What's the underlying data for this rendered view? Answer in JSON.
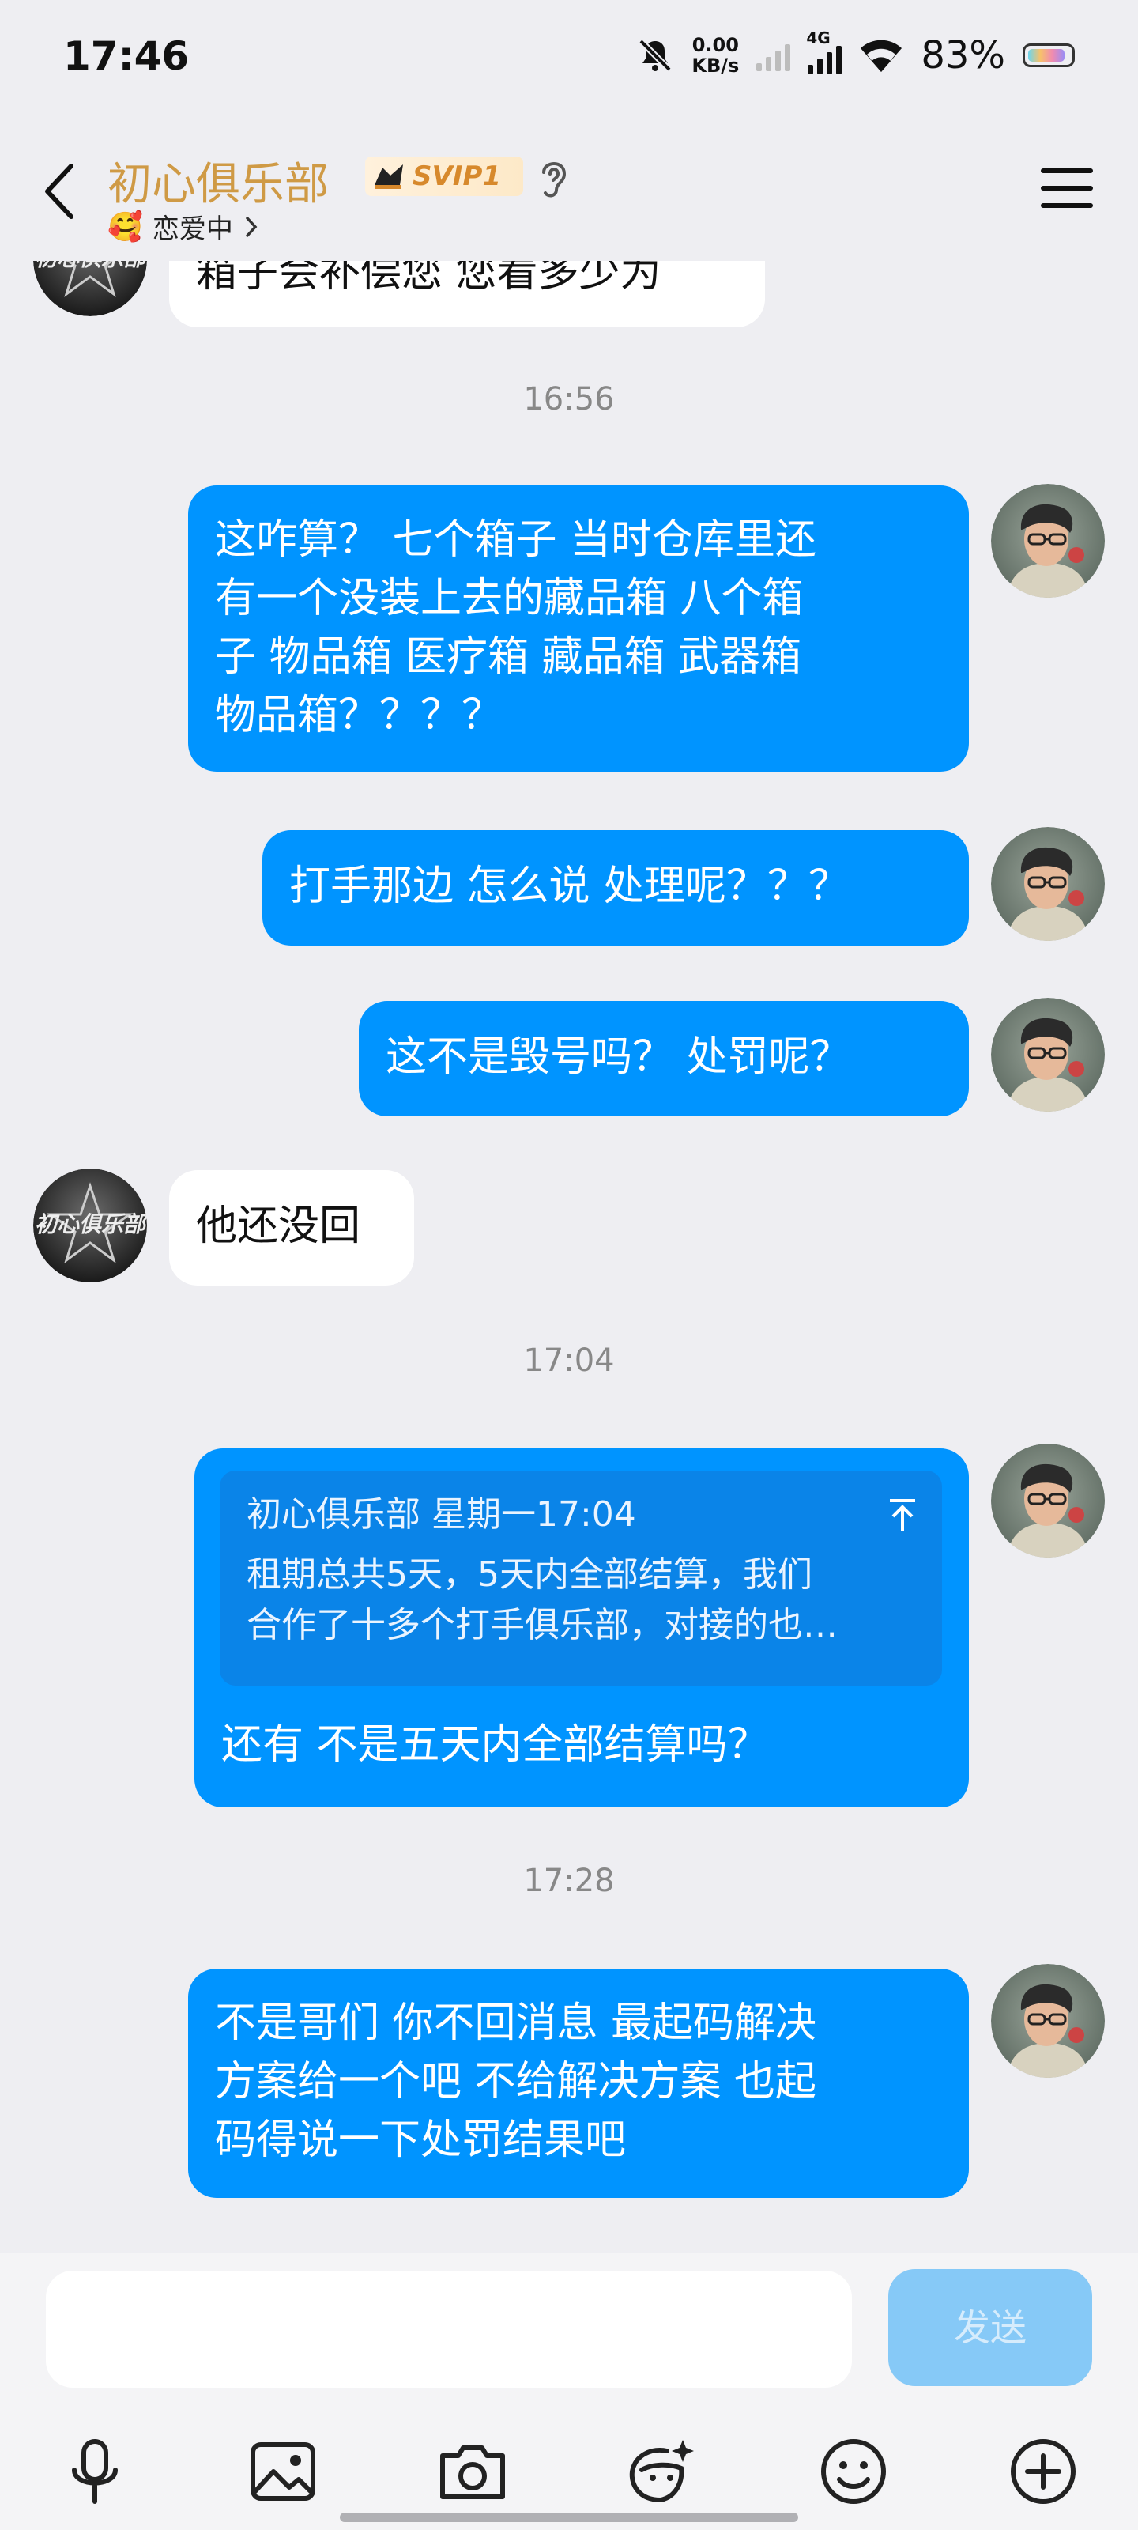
{
  "status_bar": {
    "time": "17:46",
    "net_rate_value": "0.00",
    "net_rate_unit": "KB/s",
    "network_type": "4G",
    "battery_percent": "83%"
  },
  "header": {
    "title": "初心俱乐部",
    "badge": "SVIP1",
    "relationship_status": "恋爱中",
    "status_emoji": "🥰"
  },
  "messages": [
    {
      "side": "in",
      "text": "箱子会补偿您 您看多少为"
    },
    {
      "type": "time",
      "text": "16:56"
    },
    {
      "side": "out",
      "lines": [
        "这咋算？ 七个箱子 当时仓库里还",
        "有一个没装上去的藏品箱 八个箱",
        "子 物品箱 医疗箱 藏品箱 武器箱",
        "物品箱？？？？"
      ]
    },
    {
      "side": "out",
      "text": "打手那边 怎么说 处理呢？？？"
    },
    {
      "side": "out",
      "text": "这不是毁号吗？ 处罚呢？"
    },
    {
      "side": "in",
      "text": "他还没回"
    },
    {
      "type": "time",
      "text": "17:04"
    },
    {
      "side": "out",
      "quote_header": "初心俱乐部 星期一17:04",
      "quote_lines": [
        "租期总共5天，5天内全部结算，我们",
        "合作了十多个打手俱乐部，对接的也…"
      ],
      "text": "还有 不是五天内全部结算吗？"
    },
    {
      "type": "time",
      "text": "17:28"
    },
    {
      "side": "out",
      "lines": [
        "不是哥们 你不回消息 最起码解决",
        "方案给一个吧 不给解决方案 也起",
        "码得说一下处罚结果吧"
      ]
    }
  ],
  "input": {
    "placeholder": "",
    "send_label": "发送"
  },
  "toolbar": [
    "microphone-icon",
    "image-icon",
    "camera-icon",
    "sticker-icon",
    "emoji-icon",
    "plus-icon"
  ],
  "colors": {
    "bubble_out": "#0094ff",
    "bubble_in": "#ffffff",
    "title_gold": "#cf9a45",
    "background": "#eeeef2",
    "send_disabled": "#86c9f7"
  },
  "club_avatar_text": "初心俱乐部"
}
